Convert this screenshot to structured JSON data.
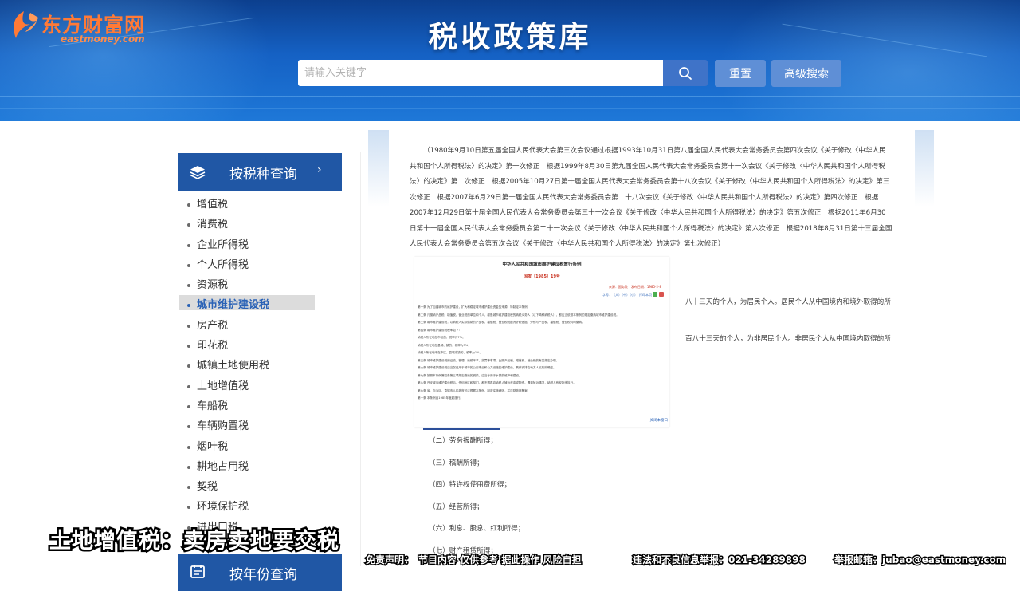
{
  "brand": {
    "name_cn": "东方财富网",
    "name_en": "eastmoney.com",
    "logo_icon": "eastmoney-logo"
  },
  "header": {
    "title": "税收政策库",
    "search_placeholder": "请输入关键字",
    "search_icon": "search-icon",
    "reset_label": "重置",
    "advanced_label": "高级搜索"
  },
  "sidebar": {
    "category_label": "按税种查询",
    "category_icon": "layers-icon",
    "items": [
      {
        "label": "增值税"
      },
      {
        "label": "消费税"
      },
      {
        "label": "企业所得税"
      },
      {
        "label": "个人所得税"
      },
      {
        "label": "资源税"
      },
      {
        "label": "城市维护建设税",
        "active": true
      },
      {
        "label": "房产税"
      },
      {
        "label": "印花税"
      },
      {
        "label": "城镇土地使用税"
      },
      {
        "label": "土地增值税"
      },
      {
        "label": "车船税"
      },
      {
        "label": "车辆购置税"
      },
      {
        "label": "烟叶税"
      },
      {
        "label": "耕地占用税"
      },
      {
        "label": "契税"
      },
      {
        "label": "环境保护税"
      },
      {
        "label": "进出口税"
      }
    ],
    "second_category_label": "按年份查询",
    "second_category_icon": "calendar-icon"
  },
  "content": {
    "intro": "（1980年9月10日第五届全国人民代表大会第三次会议通过根据1993年10月31日第八届全国人民代表大会常务委员会第四次会议《关于修改〈中华人民共和国个人所得税法〉的决定》第一次修正　根据1999年8月30日第九届全国人民代表大会常务委员会第十一次会议《关于修改〈中华人民共和国个人所得税法〉的决定》第二次修正　根据2005年10月27日第十届全国人民代表大会常务委员会第十八次会议《关于修改〈中华人民共和国个人所得税法〉的决定》第三次修正　根据2007年6月29日第十届全国人民代表大会常务委员会第二十八次会议《关于修改〈中华人民共和国个人所得税法〉的决定》第四次修正　根据2007年12月29日第十届全国人民代表大会常务委员会第三十一次会议《关于修改〈中华人民共和国个人所得税法〉的决定》第五次修正　根据2011年6月30日第十一届全国人民代表大会常务委员会第二十一次会议《关于修改〈中华人民共和国个人所得税法〉的决定》第六次修正　根据2018年8月31日第十三届全国人民代表大会常务委员会第五次会议《关于修改〈中华人民共和国个人所得税法〉的决定》第七次修正）",
    "side_line_1": "八十三天的个人，为居民个人。居民个人从中国境内和境外取得的所",
    "side_line_2": "百八十三天的个人，为非居民个人。非居民个人从中国境内取得的所",
    "income_items": [
      "（二）劳务报酬所得；",
      "（三）稿酬所得；",
      "（四）特许权使用费所得；",
      "（五）经营所得；",
      "（六）利息、股息、红利所得；",
      "（七）财产租赁所得；"
    ]
  },
  "doc_image": {
    "title": "中华人民共和国城市维护建设税暂行条例",
    "number": "国发〔1985〕19号",
    "meta": "来源：国务院　发布日期：1985-2-8",
    "tools": "字号：〔大〕〔中〕〔小〕　打印本页",
    "body": [
      "第一条 为了加强城市的维护建设，扩大和稳定城市维护建设资金的来源，特制定本条例。",
      "第二条 凡缴纳产品税、增值税、营业税的单位和个人，都是城市维护建设税的纳税义务人（以下简称纳税人），都应当依照本条例的规定缴纳城市维护建设税。",
      "第三条 城市维护建设税，以纳税人实际缴纳的产品税、增值税、营业税税额为计税依据，分别与产品税、增值税、营业税同时缴纳。",
      "第四条 城市维护建设税税率如下：",
      "纳税人所在地在市区的，税率为7%；",
      "纳税人所在地在县城、镇的，税率为5%；",
      "纳税人所在地不在市区、县城或镇的，税率为1%。",
      "第五条 城市维护建设税的征收、管理、纳税环节、奖罚等事项，比照产品税、增值税、营业税的有关规定办理。",
      "第六条 城市维护建设税应当保证用于城市的公用事业和公共设施的维护建设，具体安排由地方人民政府确定。",
      "第七条 按照本条例第四条第三项规定缴纳的税款，应当专用于乡镇的维护和建设。",
      "第八条 开征城市维护建设税后，任何地区和部门，都不得再向纳税人摊派资金或物资。遇到摊派情况，纳税人有权拒绝执行。",
      "第九条 省、自治区、直辖市人民政府可以根据本条例，制定实施细则，并送财政部备案。",
      "第十条 本条例自1985年度起施行。"
    ],
    "footer": "关闭本窗口"
  },
  "overlay": {
    "caption": "土地增值税：卖房卖地要交税",
    "disclaimer_left": "免责声明：　节目内容 仅供参考 据此操作 风险自担",
    "disclaimer_mid": "违法和不良信息举报：021-34289898",
    "disclaimer_right": "举报邮箱：jubao@eastmoney.com"
  },
  "colors": {
    "banner": "#1561c4",
    "sidebar_header": "#2057a5",
    "brand_orange": "#ff7a36",
    "active_text": "#2a62b6",
    "doc_number_red": "#c8301e"
  }
}
